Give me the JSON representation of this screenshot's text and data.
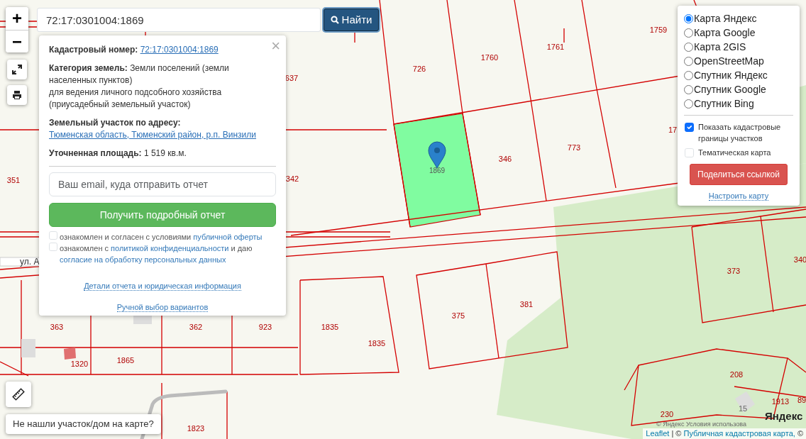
{
  "search": {
    "value": "72:17:0301004:1869",
    "button": "Найти"
  },
  "zoom_controls": [
    "+",
    "−"
  ],
  "popup": {
    "close": "×",
    "fields": [
      {
        "label": "Кадастровый номер:",
        "value": "72:17:0301004:1869",
        "kind": "link"
      },
      {
        "label": "Категория земель:",
        "value": "Земли поселений (земли населенных пунктов)",
        "kind": "text",
        "note": "для ведения личного подсобного хозяйства (приусадебный земельный участок)"
      },
      {
        "label": "Земельный участок по адресу:",
        "value": "Тюменская область, Тюменский район, р.п. Винзили",
        "kind": "link"
      },
      {
        "label": "Уточненная площадь:",
        "value": "1 519 кв.м.",
        "kind": "text"
      }
    ],
    "email": {
      "placeholder": "Ваш email, куда отправить отчет"
    },
    "report_button": "Получить подробный отчет",
    "agreements": [
      {
        "checked": false,
        "before": "ознакомлен и согласен с условиями",
        "link": "публичной оферты"
      },
      {
        "checked": false,
        "before": "ознакомлен с",
        "link": "политикой конфиденциальности",
        "after": "и даю",
        "link2": "согласие на обработку персональных данных"
      }
    ],
    "links": [
      "Детали отчета и юридическая информация",
      "Ручной выбор вариантов"
    ]
  },
  "layers": {
    "base": [
      {
        "label": "Карта Яндекс",
        "selected": true
      },
      {
        "label": "Карта Google",
        "selected": false
      },
      {
        "label": "Карта 2GIS",
        "selected": false
      },
      {
        "label": "OpenStreetMap",
        "selected": false
      },
      {
        "label": "Спутник Яндекс",
        "selected": false
      },
      {
        "label": "Спутник Google",
        "selected": false
      },
      {
        "label": "Спутник Bing",
        "selected": false
      }
    ],
    "overlays": [
      {
        "label": "Показать кадастровые границы участков",
        "checked": true
      },
      {
        "label": "Тематическая карта",
        "checked": false
      }
    ],
    "share_button": "Поделиться ссылкой",
    "settings_link": "Настроить карту"
  },
  "map": {
    "parcels": [
      "637",
      "351",
      "342",
      "726",
      "1760",
      "1761",
      "1759",
      "17",
      "346",
      "773",
      "373",
      "340",
      "375",
      "381",
      "363",
      "362",
      "923",
      "1835",
      "1835",
      "1320",
      "1865",
      "1823",
      "208",
      "15",
      "230",
      "1913",
      "89"
    ],
    "selected_parcel": "1869",
    "street": "ул. А",
    "logo": "Яндекс",
    "copyright": "© Яндекс  Условия использова"
  },
  "help_button": "Не нашли участок/дом на карте?",
  "attribution": {
    "leaflet": "Leaflet",
    "separator": "| ©",
    "source": "Публичная кадастровая карта,",
    "tail": "©"
  }
}
